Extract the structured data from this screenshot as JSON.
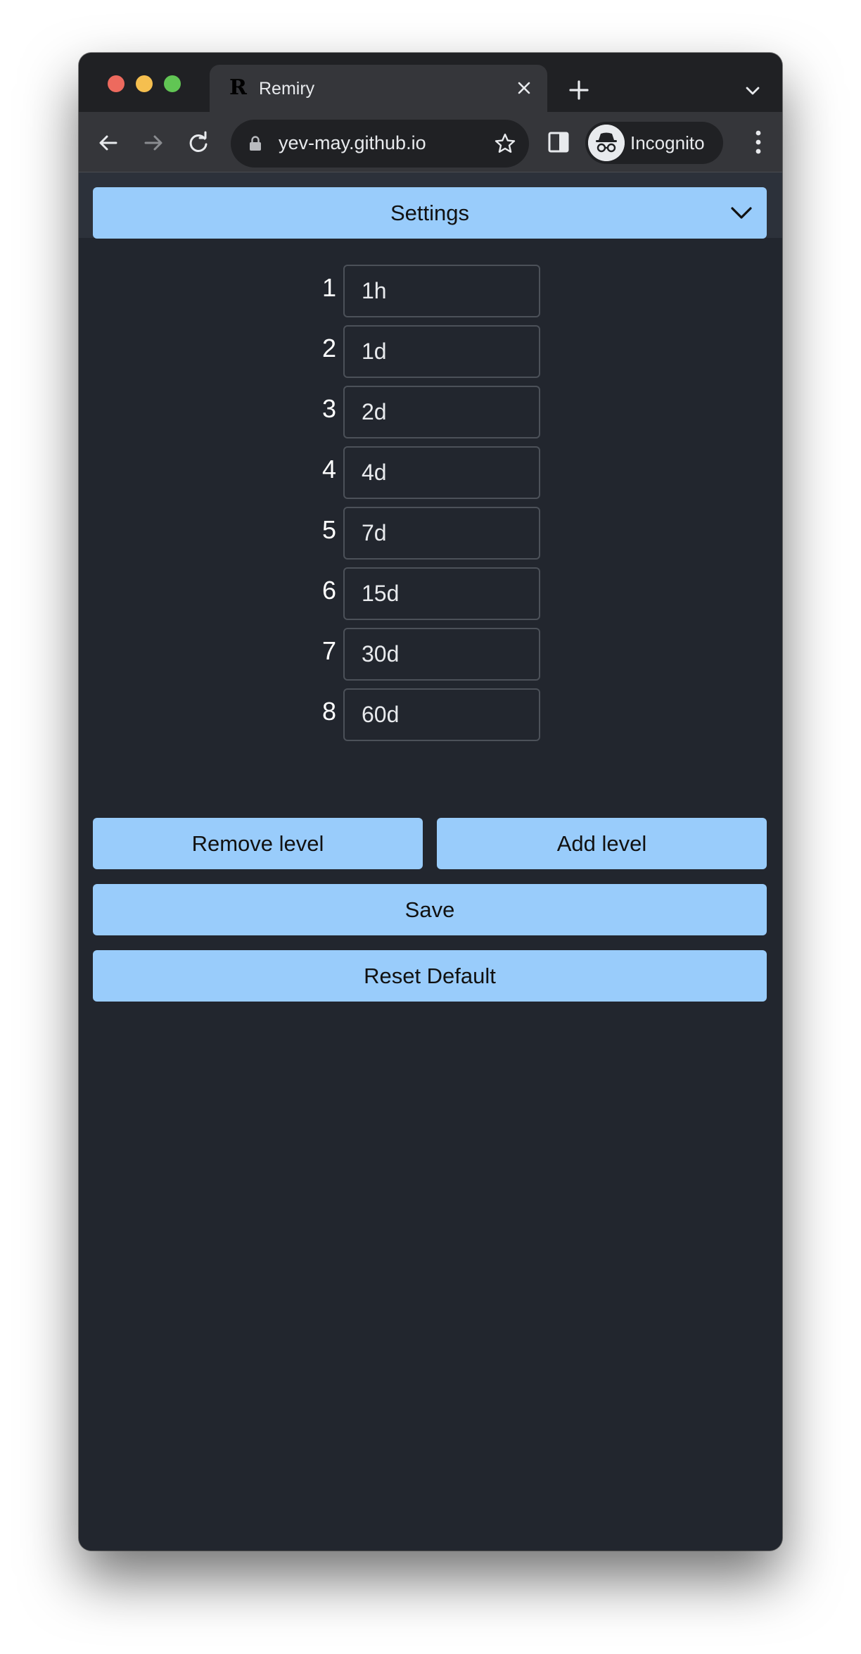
{
  "browser": {
    "tab": {
      "title": "Remiry",
      "favicon_letter": "R"
    },
    "toolbar": {
      "url": "yev-may.github.io",
      "profile_label": "Incognito"
    }
  },
  "settings": {
    "header_label": "Settings",
    "levels": [
      {
        "number": "1",
        "value": "1h"
      },
      {
        "number": "2",
        "value": "1d"
      },
      {
        "number": "3",
        "value": "2d"
      },
      {
        "number": "4",
        "value": "4d"
      },
      {
        "number": "5",
        "value": "7d"
      },
      {
        "number": "6",
        "value": "15d"
      },
      {
        "number": "7",
        "value": "30d"
      },
      {
        "number": "8",
        "value": "60d"
      }
    ],
    "buttons": {
      "remove_level": "Remove level",
      "add_level": "Add level",
      "save": "Save",
      "reset_default": "Reset Default"
    }
  },
  "colors": {
    "accent_button": "#99ccfb",
    "page_background": "#22262e"
  }
}
